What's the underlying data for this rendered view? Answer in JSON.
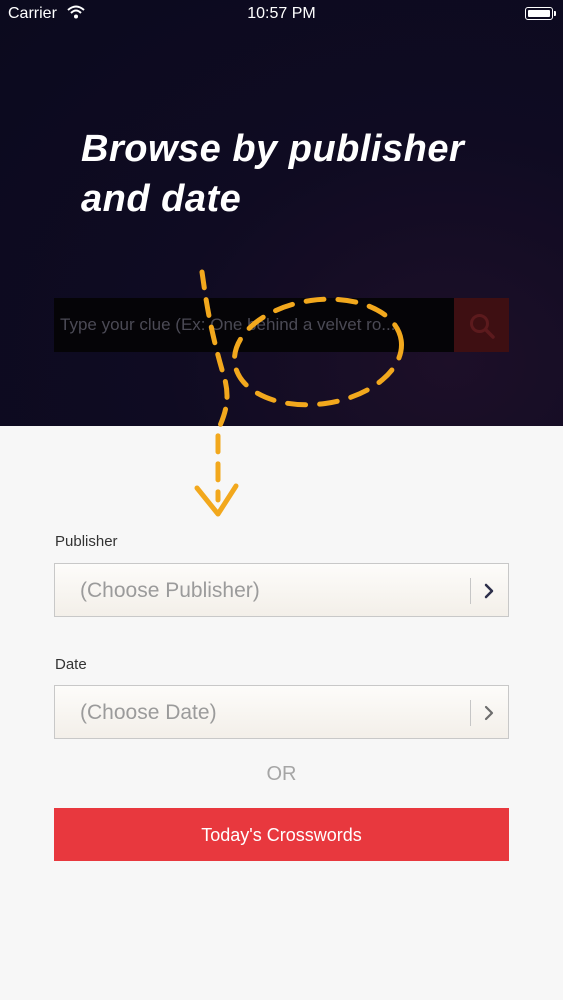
{
  "status_bar": {
    "carrier": "Carrier",
    "time": "10:57 PM"
  },
  "hero": {
    "headline": "Browse by publisher and date",
    "search": {
      "placeholder": "Type your clue (Ex: One behind a velvet ro...",
      "icon": "search-icon"
    }
  },
  "form": {
    "publisher": {
      "label": "Publisher",
      "value": "(Choose Publisher)"
    },
    "date": {
      "label": "Date",
      "value": "(Choose Date)"
    },
    "or_text": "OR",
    "today_button": "Today's Crosswords"
  },
  "colors": {
    "hero_background": "#0b0a1e",
    "accent_red": "#e8383e",
    "annotation_orange": "#f2a81d"
  }
}
